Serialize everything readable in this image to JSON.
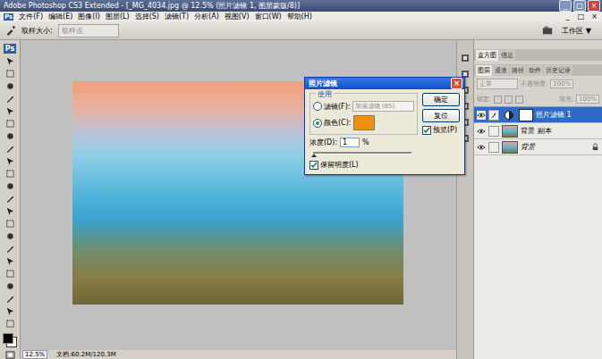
{
  "window": {
    "title": "Adobe Photoshop CS3 Extended - [_MG_4034.jpg @ 12.5% (照片滤镜 1, 图层蒙版/8)]",
    "controls": [
      "_",
      "□",
      "×"
    ]
  },
  "menu": {
    "logo": "Ps",
    "items": [
      "文件(F)",
      "编辑(E)",
      "图像(I)",
      "图层(L)",
      "选择(S)",
      "滤镜(T)",
      "分析(A)",
      "视图(V)",
      "窗口(W)",
      "帮助(H)"
    ],
    "doc_controls": [
      "_",
      "□",
      "×"
    ]
  },
  "options": {
    "label": "取样大小:",
    "value": "取样点",
    "disabled": true,
    "workspace": "工作区 ▼"
  },
  "toolbox": {
    "logo": "Ps"
  },
  "dialog": {
    "title": "照片滤镜",
    "close": "×",
    "group": "使用",
    "choices": [
      {
        "label": "滤镜(F):",
        "kind": "filter",
        "selected": false,
        "value": "加温滤镜 (85)",
        "disabled": true
      },
      {
        "label": "颜色(C):",
        "kind": "color",
        "selected": true,
        "color": "#f0900c"
      }
    ],
    "buttons": [
      "确定",
      "复位"
    ],
    "preview": {
      "label": "预览(P)",
      "checked": true
    },
    "density": {
      "label": "浓度(D):",
      "value": "1",
      "unit": "%",
      "level": 0.01
    },
    "preserve": {
      "label": "保留明度(L)",
      "checked": true
    }
  },
  "panels": {
    "top_tabs": [
      {
        "label": "直方图",
        "selected": true
      },
      {
        "label": "信息",
        "selected": false
      }
    ],
    "tabs": [
      {
        "label": "图层",
        "selected": true
      },
      {
        "label": "通道",
        "selected": false
      },
      {
        "label": "路径",
        "selected": false
      },
      {
        "label": "动作",
        "selected": false
      },
      {
        "label": "历史记录",
        "selected": false
      }
    ],
    "blend": "正常",
    "opacity_label": "不透明度:",
    "opacity": "100%",
    "lock_label": "锁定:",
    "fill_label": "填充:",
    "fill": "100%",
    "disabled": true,
    "layers": [
      {
        "name": "照片滤镜 1",
        "kind": "adjustment",
        "selected": true,
        "visible": true,
        "locked": false
      },
      {
        "name": "背景 副本",
        "kind": "image",
        "selected": false,
        "visible": true,
        "locked": false
      },
      {
        "name": "背景",
        "kind": "image",
        "selected": false,
        "visible": true,
        "locked": true
      }
    ]
  },
  "status": {
    "zoom": "12.5%",
    "doc": "文档:60.2M/120.3M"
  }
}
